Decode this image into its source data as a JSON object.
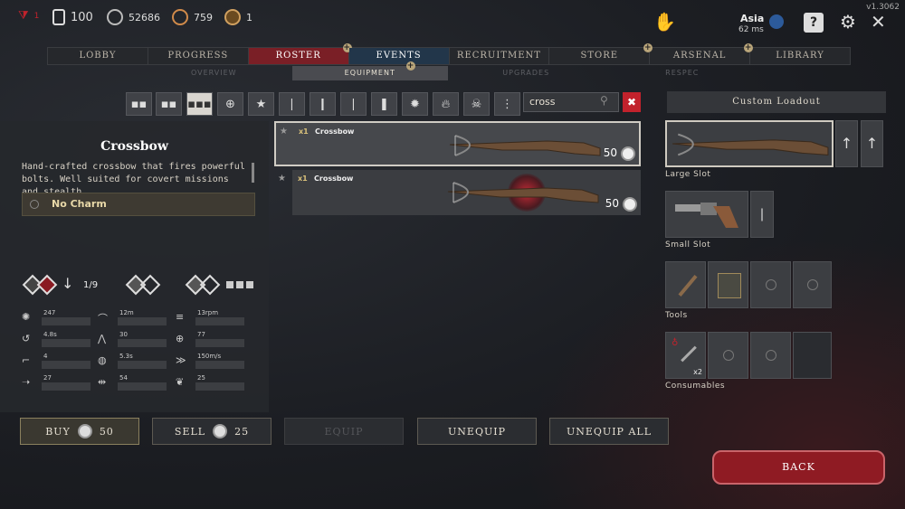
{
  "version": "v1.3062",
  "topbar": {
    "level": "1",
    "hunters": "100",
    "hunt_dollars": "52686",
    "blood_bonds": "759",
    "event_points": "1",
    "server": "Asia",
    "ping": "62 ms"
  },
  "nav": {
    "lobby": "LOBBY",
    "progress": "PROGRESS",
    "roster": "ROSTER",
    "events": "EVENTS",
    "recruitment": "RECRUITMENT",
    "store": "STORE",
    "arsenal": "ARSENAL",
    "library": "LIBRARY"
  },
  "subnav": {
    "overview": "OVERVIEW",
    "equipment": "EQUIPMENT",
    "upgrades": "UPGRADES",
    "respec": "RESPEC"
  },
  "search": {
    "value": "cross",
    "clear": "✖"
  },
  "item": {
    "title": "Crossbow",
    "description": "Hand-crafted crossbow that fires powerful bolts. Well suited for covert missions and stealth",
    "charm": "No Charm",
    "ammo": "1/9"
  },
  "stats": {
    "s1": "247",
    "s2": "4.8s",
    "s3": "4",
    "s4": "27",
    "s5": "12m",
    "s6": "30",
    "s7": "5.3s",
    "s8": "54",
    "s9": "13rpm",
    "s10": "77",
    "s11": "150m/s",
    "s12": "25"
  },
  "list": [
    {
      "qty": "x1",
      "name": "Crossbow",
      "price": "50"
    },
    {
      "qty": "x1",
      "name": "Crossbow",
      "price": "50"
    }
  ],
  "loadout": {
    "title": "Custom Loadout",
    "large": "Large Slot",
    "small": "Small Slot",
    "tools": "Tools",
    "consumables": "Consumables",
    "consumable_count": "x2"
  },
  "actions": {
    "buy": "BUY",
    "buy_price": "50",
    "sell": "SELL",
    "sell_price": "25",
    "equip": "EQUIP",
    "unequip": "UNEQUIP",
    "unequip_all": "UNEQUIP ALL",
    "back": "BACK"
  }
}
